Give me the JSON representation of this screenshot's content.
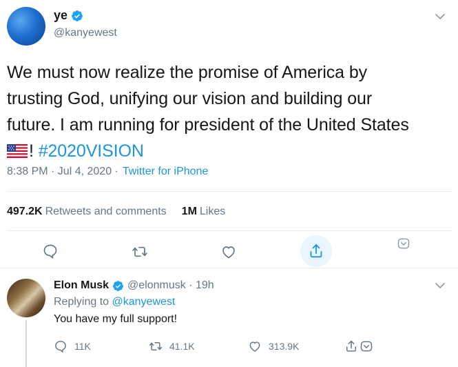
{
  "tweet": {
    "display_name": "ye",
    "handle": "@kanyewest",
    "text_lines": [
      "We must now realize the promise of America by",
      "trusting God, unifying our vision and building our",
      "future. I am running for president of the United States"
    ],
    "text_tail_bang": "! ",
    "hashtag": "#2020VISION",
    "time": "8:38 PM · Jul 4, 2020 ·",
    "source": "Twitter for iPhone",
    "retweets_count": "497.2K",
    "retweets_label": "Retweets and comments",
    "likes_count": "1M",
    "likes_label": "Likes"
  },
  "reply": {
    "display_name": "Elon Musk",
    "handle": "@elonmusk · 19h",
    "replying_prefix": "Replying to ",
    "replying_mention": "@kanyewest",
    "text": "You have my full support!",
    "reply_count": "11K",
    "retweet_count": "41.1K",
    "like_count": "313.9K"
  },
  "colors": {
    "accent": "#1b95e0",
    "muted": "#657786",
    "text": "#14171a",
    "divider": "#e6ecf0"
  },
  "icons": {
    "verified": "verified-badge-icon",
    "caret": "chevron-down-icon",
    "reply": "reply-icon",
    "retweet": "retweet-icon",
    "like": "heart-icon",
    "share": "share-icon",
    "more": "more-icon"
  }
}
